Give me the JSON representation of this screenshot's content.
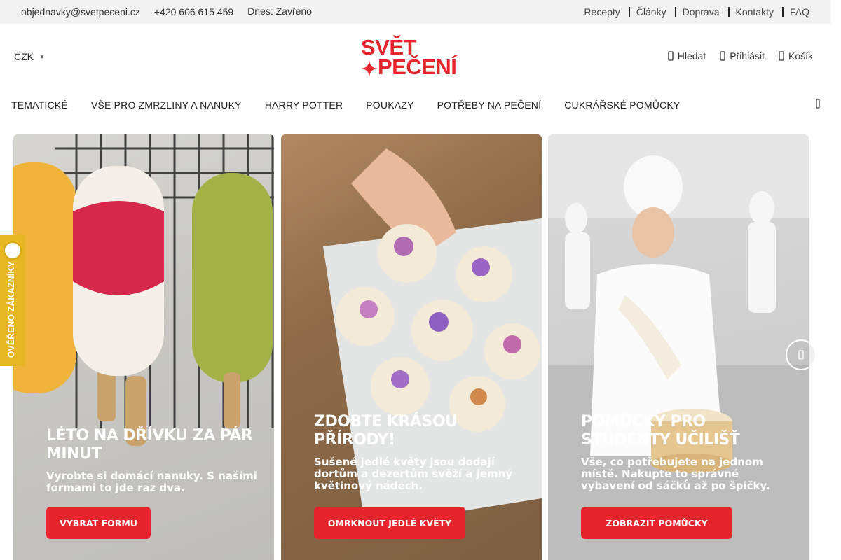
{
  "topbar": {
    "email": "objednavky@svetpeceni.cz",
    "phone": "+420 606 615 459",
    "hours": "Dnes: Zavřeno",
    "links": [
      "Recepty",
      "Články",
      "Doprava",
      "Kontakty",
      "FAQ"
    ]
  },
  "header": {
    "currency": "CZK",
    "logo_line1": "SVĚT",
    "logo_line2": "PEČENÍ",
    "search": "Hledat",
    "login": "Přihlásit",
    "cart": "Košík"
  },
  "nav": {
    "items": [
      "TEMATICKÉ",
      "VŠE PRO ZMRZLINY A NANUKY",
      "HARRY POTTER",
      "POUKAZY",
      "POTŘEBY NA PEČENÍ",
      "CUKRÁŘSKÉ POMŮCKY"
    ]
  },
  "banners": [
    {
      "title": "LÉTO NA DŘÍVKU ZA PÁR MINUT",
      "text": "Vyrobte si domácí nanuky. S našimi formami to jde raz dva.",
      "cta": "VYBRAT FORMU"
    },
    {
      "title": "ZDOBTE KRÁSOU PŘÍRODY!",
      "text": "Sušené jedlé květy jsou dodají dortům a dezertům svěží a jemný květinový nádech.",
      "cta": "OMRKNOUT JEDLÉ KVĚTY"
    },
    {
      "title": "POMŮCKY PRO STUDENTY UČILIŠŤ",
      "text": "Vše, co potřebujete na jednom místě. Nakupte to správné vybavení od sáčků až po špičky.",
      "cta": "ZOBRAZIT POMŮCKY"
    }
  ],
  "verified_badge": "OVĚŘENO ZÁKAZNÍKY",
  "colors": {
    "brand_red": "#e6242b",
    "badge_yellow": "#e6b722",
    "topbar_bg": "#f2f2f2"
  }
}
